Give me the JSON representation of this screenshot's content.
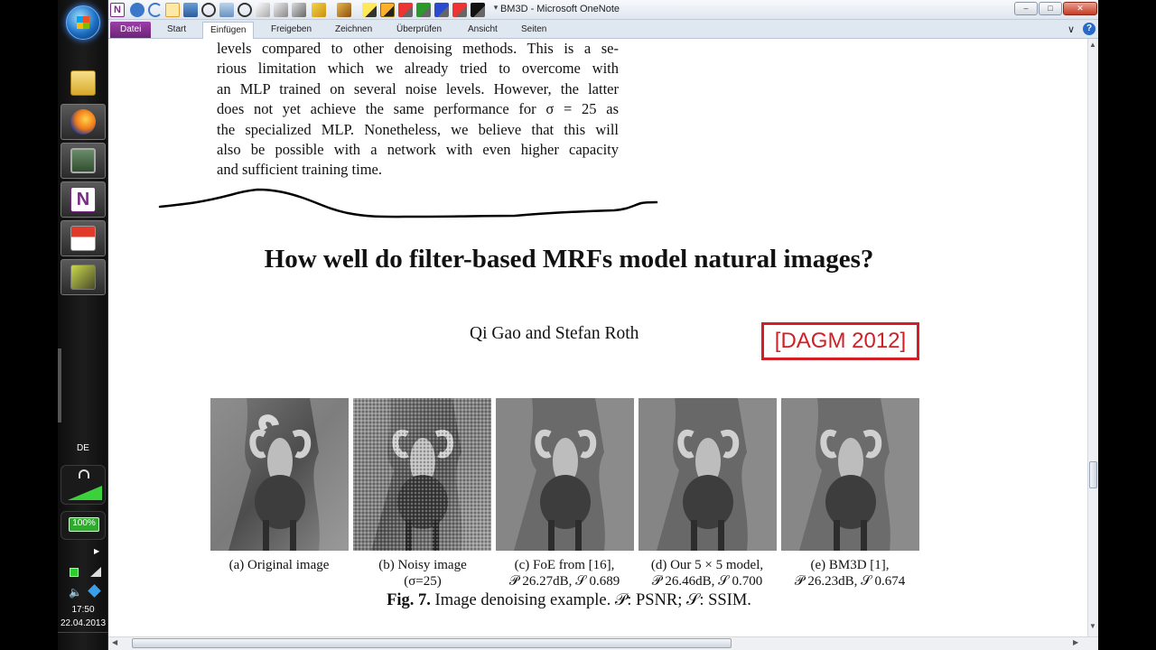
{
  "window": {
    "title": "BM3D - Microsoft OneNote",
    "controls": {
      "minimize": "–",
      "maximize": "□",
      "close": "✕"
    }
  },
  "ribbon": {
    "tabs": [
      {
        "label": "Datei"
      },
      {
        "label": "Start"
      },
      {
        "label": "Einfügen"
      },
      {
        "label": "Freigeben"
      },
      {
        "label": "Zeichnen"
      },
      {
        "label": "Überprüfen"
      },
      {
        "label": "Ansicht"
      },
      {
        "label": "Seiten"
      }
    ],
    "selected_tab": "Einfügen",
    "help_icon": "?"
  },
  "taskbar": {
    "language": "DE",
    "battery": "100%",
    "clock_time": "17:50",
    "clock_date": "22.04.2013",
    "apps": [
      "folder-icon",
      "firefox-icon",
      "computer-icon",
      "onenote-icon",
      "pdf-icon",
      "app-icon"
    ]
  },
  "note": {
    "paragraph_lines": [
      "levels compared to other denoising methods.  This is a se-",
      "rious limitation which we already tried to overcome with",
      "an MLP trained on several noise levels. However, the latter",
      "does not yet achieve the same performance for σ = 25 as",
      "the specialized MLP. Nonetheless, we believe that this will",
      "also be possible with a network with even higher capacity",
      "and sufficient training time."
    ],
    "heading": "How well do filter-based MRFs model natural images?",
    "authors": "Qi Gao and Stefan Roth",
    "tag": "[DAGM 2012]",
    "figure": {
      "panels": [
        {
          "line1": "(a)  Original image",
          "line2": ""
        },
        {
          "line1": "(b)  Noisy image",
          "line2": "(σ=25)"
        },
        {
          "line1": "(c)  FoE from [16],",
          "line2": "𝒫 26.27dB, 𝒮 0.689"
        },
        {
          "line1": "(d)  Our 5 × 5 model,",
          "line2": "𝒫 26.46dB, 𝒮 0.700"
        },
        {
          "line1": "(e)  BM3D [1],",
          "line2": "𝒫 26.23dB, 𝒮 0.674"
        }
      ],
      "caption_label": "Fig. 7.",
      "caption_text": " Image denoising example. 𝒫: PSNR; 𝒮: SSIM."
    }
  }
}
